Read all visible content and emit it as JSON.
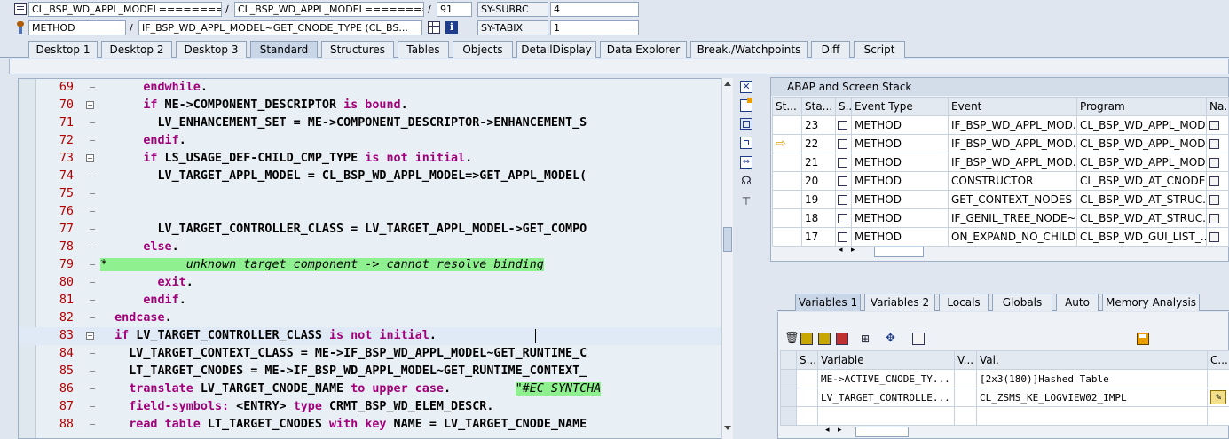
{
  "top": {
    "row1": {
      "program": "CL_BSP_WD_APPL_MODEL==========...",
      "include": "CL_BSP_WD_APPL_MODEL==========...",
      "line": "91",
      "sysvar": "SY-SUBRC",
      "sysval": "4"
    },
    "row2": {
      "type": "METHOD",
      "event": "IF_BSP_WD_APPL_MODEL~GET_CNODE_TYPE (CL_BS...",
      "sysvar": "SY-TABIX",
      "sysval": "1"
    }
  },
  "tabs": [
    "Desktop 1",
    "Desktop 2",
    "Desktop 3",
    "Standard",
    "Structures",
    "Tables",
    "Objects",
    "DetailDisplay",
    "Data Explorer",
    "Break./Watchpoints",
    "Diff",
    "Script"
  ],
  "editor": {
    "lines": [
      {
        "n": "69",
        "code": "      endwhile."
      },
      {
        "n": "70",
        "code": "      if ME->COMPONENT_DESCRIPTOR is bound."
      },
      {
        "n": "71",
        "code": "        LV_ENHANCEMENT_SET = ME->COMPONENT_DESCRIPTOR->ENHANCEMENT_S"
      },
      {
        "n": "72",
        "code": "      endif."
      },
      {
        "n": "73",
        "code": "      if LS_USAGE_DEF-CHILD_CMP_TYPE is not initial."
      },
      {
        "n": "74",
        "code": "        LV_TARGET_APPL_MODEL = CL_BSP_WD_APPL_MODEL=>GET_APPL_MODEL("
      },
      {
        "n": "75",
        "code": ""
      },
      {
        "n": "76",
        "code": ""
      },
      {
        "n": "77",
        "code": "        LV_TARGET_CONTROLLER_CLASS = LV_TARGET_APPL_MODEL->GET_COMPO"
      },
      {
        "n": "78",
        "code": "      else."
      },
      {
        "n": "79",
        "code": "        unknown target component -> cannot resolve binding"
      },
      {
        "n": "80",
        "code": "        exit."
      },
      {
        "n": "81",
        "code": "      endif."
      },
      {
        "n": "82",
        "code": "  endcase."
      },
      {
        "n": "83",
        "code": "  if LV_TARGET_CONTROLLER_CLASS is not initial."
      },
      {
        "n": "84",
        "code": "    LV_TARGET_CONTEXT_CLASS = ME->IF_BSP_WD_APPL_MODEL~GET_RUNTIME_C"
      },
      {
        "n": "85",
        "code": "    LT_TARGET_CNODES = ME->IF_BSP_WD_APPL_MODEL~GET_RUNTIME_CONTEXT_"
      },
      {
        "n": "86",
        "code": "    translate LV_TARGET_CNODE_NAME to upper case.         \"#EC SYNTCHA"
      },
      {
        "n": "87",
        "code": "    field-symbols: <ENTRY> type CRMT_BSP_WD_ELEM_DESCR."
      },
      {
        "n": "88",
        "code": "    read table LT_TARGET_CNODES with key NAME = LV_TARGET_CNODE_NAME"
      }
    ],
    "comment_star": "*"
  },
  "stack": {
    "title": "ABAP and Screen Stack",
    "headers": [
      "St...",
      "Sta...",
      "S..",
      "Event Type",
      "Event",
      "Program",
      "Na.."
    ],
    "rows": [
      {
        "level": "23",
        "type": "METHOD",
        "event": "IF_BSP_WD_APPL_MOD...",
        "program": "CL_BSP_WD_APPL_MOD..."
      },
      {
        "level": "22",
        "type": "METHOD",
        "event": "IF_BSP_WD_APPL_MOD...",
        "program": "CL_BSP_WD_APPL_MOD..."
      },
      {
        "level": "21",
        "type": "METHOD",
        "event": "IF_BSP_WD_APPL_MOD...",
        "program": "CL_BSP_WD_APPL_MOD..."
      },
      {
        "level": "20",
        "type": "METHOD",
        "event": "CONSTRUCTOR",
        "program": "CL_BSP_WD_AT_CNODE..."
      },
      {
        "level": "19",
        "type": "METHOD",
        "event": "GET_CONTEXT_NODES",
        "program": "CL_BSP_WD_AT_STRUC..."
      },
      {
        "level": "18",
        "type": "METHOD",
        "event": "IF_GENIL_TREE_NODE~...",
        "program": "CL_BSP_WD_AT_STRUC..."
      },
      {
        "level": "17",
        "type": "METHOD",
        "event": "ON_EXPAND_NO_CHILD...",
        "program": "CL_BSP_WD_GUI_LIST_..."
      }
    ]
  },
  "vartabs": [
    "Variables 1",
    "Variables 2",
    "Locals",
    "Globals",
    "Auto",
    "Memory Analysis"
  ],
  "vars": {
    "headers": [
      "S...",
      "Variable",
      "V...",
      "Val.",
      "C..."
    ],
    "rows": [
      {
        "name": "ME->ACTIVE_CNODE_TY...",
        "val": "[2x3(180)]Hashed Table"
      },
      {
        "name": "LV_TARGET_CONTROLLE...",
        "val": "CL_ZSMS_KE_LOGVIEW02_IMPL"
      }
    ]
  },
  "colors": {
    "accent": "#c9d6e8",
    "linenum": "#b00000",
    "keyword": "#a0007a",
    "comment_bg": "#8ef08e"
  }
}
